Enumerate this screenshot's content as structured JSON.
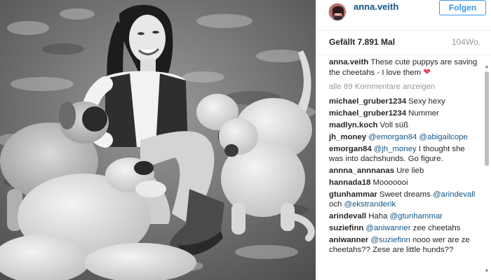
{
  "post": {
    "username": "anna.veith",
    "follow_label": "Folgen",
    "likes": "Gefällt 7.891 Mal",
    "age": "104Wo.",
    "caption_author": "anna.veith",
    "caption_text": "These cute puppys are saving the cheetahs - I love them",
    "load_more": "alle 89 Kommentare anzeigen"
  },
  "comments": [
    {
      "author": "michael_gruber1234",
      "parts": [
        {
          "t": "Sexy hexy"
        }
      ]
    },
    {
      "author": "michael_gruber1234",
      "parts": [
        {
          "t": "Nummer"
        }
      ]
    },
    {
      "author": "madlyn.koch",
      "parts": [
        {
          "t": "Voll süß"
        }
      ]
    },
    {
      "author": "jh_money",
      "parts": [
        {
          "m": "@emorgan84"
        },
        {
          "t": " "
        },
        {
          "m": "@abigailcope"
        }
      ]
    },
    {
      "author": "emorgan84",
      "parts": [
        {
          "m": "@jh_money"
        },
        {
          "t": " I thought she was into dachshunds. Go figure."
        }
      ]
    },
    {
      "author": "annna_annnanas",
      "parts": [
        {
          "t": "Ure lieb"
        }
      ]
    },
    {
      "author": "hannada18",
      "parts": [
        {
          "t": "Mooooooi"
        }
      ]
    },
    {
      "author": "gtunhammar",
      "parts": [
        {
          "t": "Sweet dreams "
        },
        {
          "m": "@arindevall"
        },
        {
          "t": " och "
        },
        {
          "m": "@ekstranderik"
        }
      ]
    },
    {
      "author": "arindevall",
      "parts": [
        {
          "t": "Haha "
        },
        {
          "m": "@gtunhammar"
        }
      ]
    },
    {
      "author": "suziefinn",
      "parts": [
        {
          "m": "@aniwanner"
        },
        {
          "t": " zee cheetahs"
        }
      ]
    },
    {
      "author": "aniwanner",
      "parts": [
        {
          "m": "@suziefinn"
        },
        {
          "t": " nooo wer are ze cheetahs?? Zese are little hunds??"
        }
      ]
    }
  ],
  "icons": {
    "heart": "heart-icon",
    "scroll_up": "scroll-up-arrow-icon",
    "scroll_down": "scroll-down-arrow-icon"
  },
  "colors": {
    "link": "#125688",
    "follow": "#3897f0",
    "heart": "#ed4956"
  }
}
